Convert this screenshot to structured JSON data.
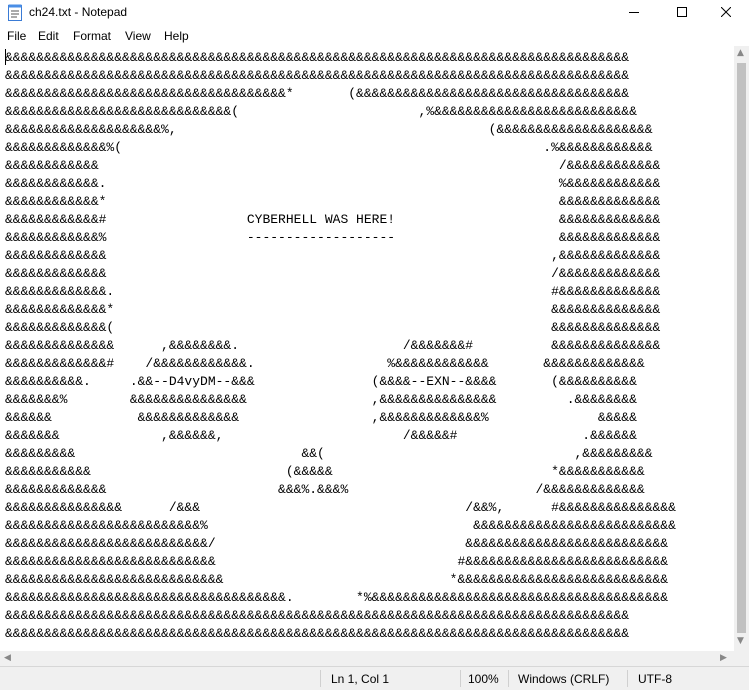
{
  "window": {
    "title": "ch24.txt - Notepad",
    "icons": {
      "app": "notepad-icon",
      "minimize": "minimize-icon",
      "maximize": "maximize-icon",
      "close": "close-icon"
    }
  },
  "menu": {
    "file": "File",
    "edit": "Edit",
    "format": "Format",
    "view": "View",
    "help": "Help"
  },
  "document": {
    "content": "&&&&&&&&&&&&&&&&&&&&&&&&&&&&&&&&&&&&&&&&&&&&&&&&&&&&&&&&&&&&&&&&&&&&&&&&&&&&&&&&\n&&&&&&&&&&&&&&&&&&&&&&&&&&&&&&&&&&&&&&&&&&&&&&&&&&&&&&&&&&&&&&&&&&&&&&&&&&&&&&&&\n&&&&&&&&&&&&&&&&&&&&&&&&&&&&&&&&&&&&*       (&&&&&&&&&&&&&&&&&&&&&&&&&&&&&&&&&&&\n&&&&&&&&&&&&&&&&&&&&&&&&&&&&&(                       ,%&&&&&&&&&&&&&&&&&&&&&&&&&&\n&&&&&&&&&&&&&&&&&&&&%,                                        (&&&&&&&&&&&&&&&&&&&&\n&&&&&&&&&&&&&%(                                                      .%&&&&&&&&&&&&\n&&&&&&&&&&&&                                                           /&&&&&&&&&&&&\n&&&&&&&&&&&&.                                                          %&&&&&&&&&&&&\n&&&&&&&&&&&&*                                                          &&&&&&&&&&&&&\n&&&&&&&&&&&&#                  CYBERHELL WAS HERE!                     &&&&&&&&&&&&&\n&&&&&&&&&&&&%                  -------------------                     &&&&&&&&&&&&&\n&&&&&&&&&&&&&                                                         ,&&&&&&&&&&&&&\n&&&&&&&&&&&&&                                                         /&&&&&&&&&&&&&\n&&&&&&&&&&&&&.                                                        #&&&&&&&&&&&&&\n&&&&&&&&&&&&&*                                                        &&&&&&&&&&&&&&\n&&&&&&&&&&&&&(                                                        &&&&&&&&&&&&&&\n&&&&&&&&&&&&&&      ,&&&&&&&&.                     /&&&&&&&#          &&&&&&&&&&&&&&\n&&&&&&&&&&&&&#    /&&&&&&&&&&&&.                 %&&&&&&&&&&&&       &&&&&&&&&&&&&\n&&&&&&&&&&.     .&&--D4vyDM--&&&               (&&&&--EXN--&&&&       (&&&&&&&&&&\n&&&&&&&%        &&&&&&&&&&&&&&&                ,&&&&&&&&&&&&&&&         .&&&&&&&&\n&&&&&&           &&&&&&&&&&&&&                 ,&&&&&&&&&&&&&%              &&&&&\n&&&&&&&             ,&&&&&&,                       /&&&&&#                .&&&&&&\n&&&&&&&&&                             &&(                                ,&&&&&&&&&\n&&&&&&&&&&&                         (&&&&&                            *&&&&&&&&&&&\n&&&&&&&&&&&&&                      &&&%.&&&%                        /&&&&&&&&&&&&&\n&&&&&&&&&&&&&&&      /&&&                                  /&&%,      #&&&&&&&&&&&&&&&\n&&&&&&&&&&&&&&&&&&&&&&&&&%                                  &&&&&&&&&&&&&&&&&&&&&&&&&&\n&&&&&&&&&&&&&&&&&&&&&&&&&&/                                &&&&&&&&&&&&&&&&&&&&&&&&&&\n&&&&&&&&&&&&&&&&&&&&&&&&&&&                               #&&&&&&&&&&&&&&&&&&&&&&&&&&\n&&&&&&&&&&&&&&&&&&&&&&&&&&&&                             *&&&&&&&&&&&&&&&&&&&&&&&&&&&\n&&&&&&&&&&&&&&&&&&&&&&&&&&&&&&&&&&&&.        *%&&&&&&&&&&&&&&&&&&&&&&&&&&&&&&&&&&&&&&\n&&&&&&&&&&&&&&&&&&&&&&&&&&&&&&&&&&&&&&&&&&&&&&&&&&&&&&&&&&&&&&&&&&&&&&&&&&&&&&&&\n&&&&&&&&&&&&&&&&&&&&&&&&&&&&&&&&&&&&&&&&&&&&&&&&&&&&&&&&&&&&&&&&&&&&&&&&&&&&&&&&"
  },
  "status": {
    "position": "Ln 1, Col 1",
    "zoom": "100%",
    "line_ending": "Windows (CRLF)",
    "encoding": "UTF-8"
  }
}
